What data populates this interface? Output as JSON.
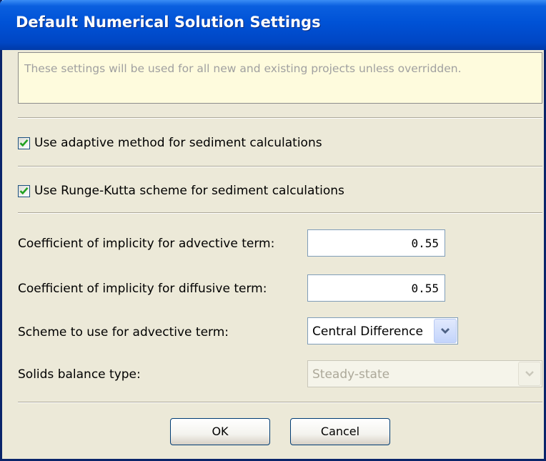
{
  "dialog": {
    "title": "Default Numerical Solution Settings",
    "info_text": "These settings will be used for all new and existing projects unless overridden."
  },
  "checkboxes": [
    {
      "label": "Use adaptive method for sediment calculations",
      "checked": true
    },
    {
      "label": "Use Runge-Kutta scheme for sediment calculations",
      "checked": true
    }
  ],
  "fields": {
    "advective_coef": {
      "label": "Coefficient of implicity for advective term:",
      "value": "0.55"
    },
    "diffusive_coef": {
      "label": "Coefficient of implicity for diffusive term:",
      "value": "0.55"
    },
    "advective_scheme": {
      "label": "Scheme to use for advective term:",
      "value": "Central Difference"
    },
    "solids_balance": {
      "label": "Solids balance type:",
      "value": "Steady-state",
      "enabled": false
    }
  },
  "buttons": {
    "ok": "OK",
    "cancel": "Cancel"
  },
  "colors": {
    "title_bar": "#0052d6",
    "info_background": "#fefbdd",
    "dialog_background": "#ece9d8",
    "checkmark": "#21a121"
  },
  "icons": {
    "check": "checkmark-icon",
    "dropdown": "chevron-down-icon"
  }
}
